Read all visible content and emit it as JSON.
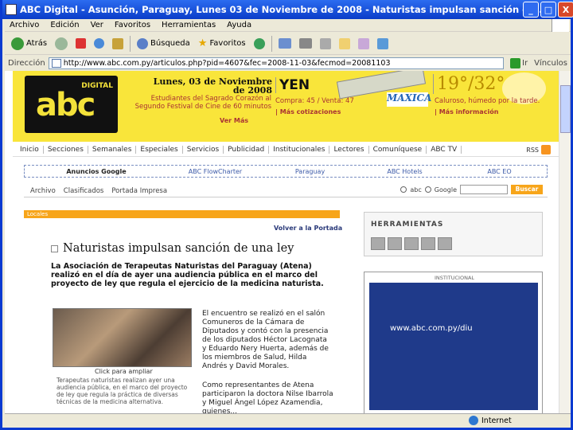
{
  "window": {
    "title": "ABC Digital - Asunción, Paraguay, Lunes 03 de Noviembre de 2008 - Naturistas impulsan sanción d - ...",
    "min": "_",
    "max": "□",
    "close": "X"
  },
  "menu": [
    "Archivo",
    "Edición",
    "Ver",
    "Favoritos",
    "Herramientas",
    "Ayuda"
  ],
  "toolbar": {
    "back": "Atrás",
    "search": "Búsqueda",
    "favorites": "Favoritos"
  },
  "address": {
    "label": "Dirección",
    "url": "http://www.abc.com.py/articulos.php?pid=4607&fec=2008-11-03&fecmod=20081103",
    "go": "Ir",
    "links": "Vínculos"
  },
  "banner": {
    "logo_small": "DIGITAL",
    "logo_big": "abc",
    "date": "Lunes, 03 de Noviembre de 2008",
    "news": "Estudiantes del Sagrado Corazón al Segundo Festival de Cine de 60 minutos",
    "ver_mas": "Ver Más",
    "currency": "YEN",
    "compra": "Compra: 45 / Venta: 47",
    "cotiz": "| Más cotizaciones",
    "maxica": "MAXICA",
    "temp_low": "19°",
    "temp_sep": "/",
    "temp_high": "32°",
    "clima": "Caluroso, húmedo por la tarde.",
    "mas_info": "| Más información"
  },
  "nav": [
    "Inicio",
    "Secciones",
    "Semanales",
    "Especiales",
    "Servicios",
    "Publicidad",
    "Institucionales",
    "Lectores",
    "Comuníquese",
    "ABC TV"
  ],
  "rss": "RSS",
  "ads": {
    "label": "Anuncios Google",
    "links": [
      "ABC FlowCharter",
      "Paraguay",
      "ABC Hotels",
      "ABC EO"
    ]
  },
  "subnav": {
    "items": [
      "Archivo",
      "Clasificados",
      "Portada Impresa"
    ],
    "opt1": "abc",
    "opt2": "Google",
    "btn": "Buscar"
  },
  "article": {
    "section": "Locales",
    "back": "Volver a la Portada",
    "headline": "Naturistas impulsan sanción de una ley",
    "lead": "La Asociación de Terapeutas Naturistas del Paraguay (Atena) realizó en el día de ayer una audiencia pública en el marco del proyecto de ley que regula el ejercicio de la medicina naturista.",
    "caption": "Click para ampliar",
    "photo_desc": "Terapeutas naturistas realizan ayer una audiencia pública, en el marco del proyecto de ley que regula la práctica de diversas técnicas de la medicina alternativa.",
    "p1": "El encuentro se realizó en el salón Comuneros de la Cámara de Diputados y contó con la presencia de los diputados Héctor Lacognata y Eduardo Nery Huerta, además de los miembros de Salud, Hilda Andrés y David Morales.",
    "p2": "Como representantes de Atena participaron la doctora Nilse Ibarrola y Miguel Ángel López Azamendia, quienes..."
  },
  "sidebar": {
    "tools_title": "HERRAMIENTAS",
    "inst_label": "INSTITUCIONAL",
    "inst_url": "www.abc.com.py/diu"
  },
  "status": {
    "zone": "Internet"
  }
}
